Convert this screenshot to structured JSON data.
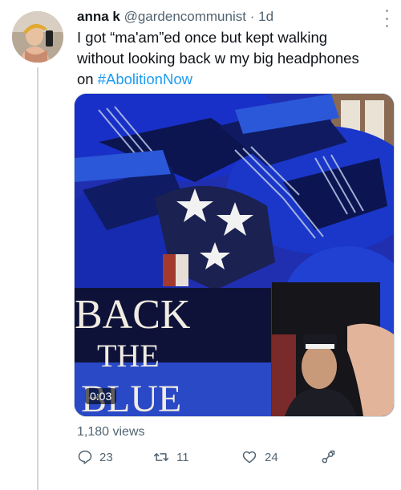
{
  "tweet": {
    "display_name": "anna k",
    "handle": "@gardencommunist",
    "separator": "·",
    "time": "1d",
    "text_main": "I got “ma'am”ed once but kept walking without looking back w my big headphones on ",
    "hashtag": "#AbolitionNow"
  },
  "media": {
    "sign_line1": "BACK",
    "sign_line2": "THE",
    "sign_line3": "BLUE",
    "timestamp": "0:03"
  },
  "stats": {
    "views": "1,180 views"
  },
  "actions": {
    "reply_count": "23",
    "retweet_count": "11",
    "like_count": "24"
  },
  "colors": {
    "link": "#1d9bf0",
    "muted": "#536471",
    "text": "#0f1419"
  },
  "icons": [
    "more-icon",
    "reply-icon",
    "retweet-icon",
    "like-icon",
    "share-icon"
  ]
}
